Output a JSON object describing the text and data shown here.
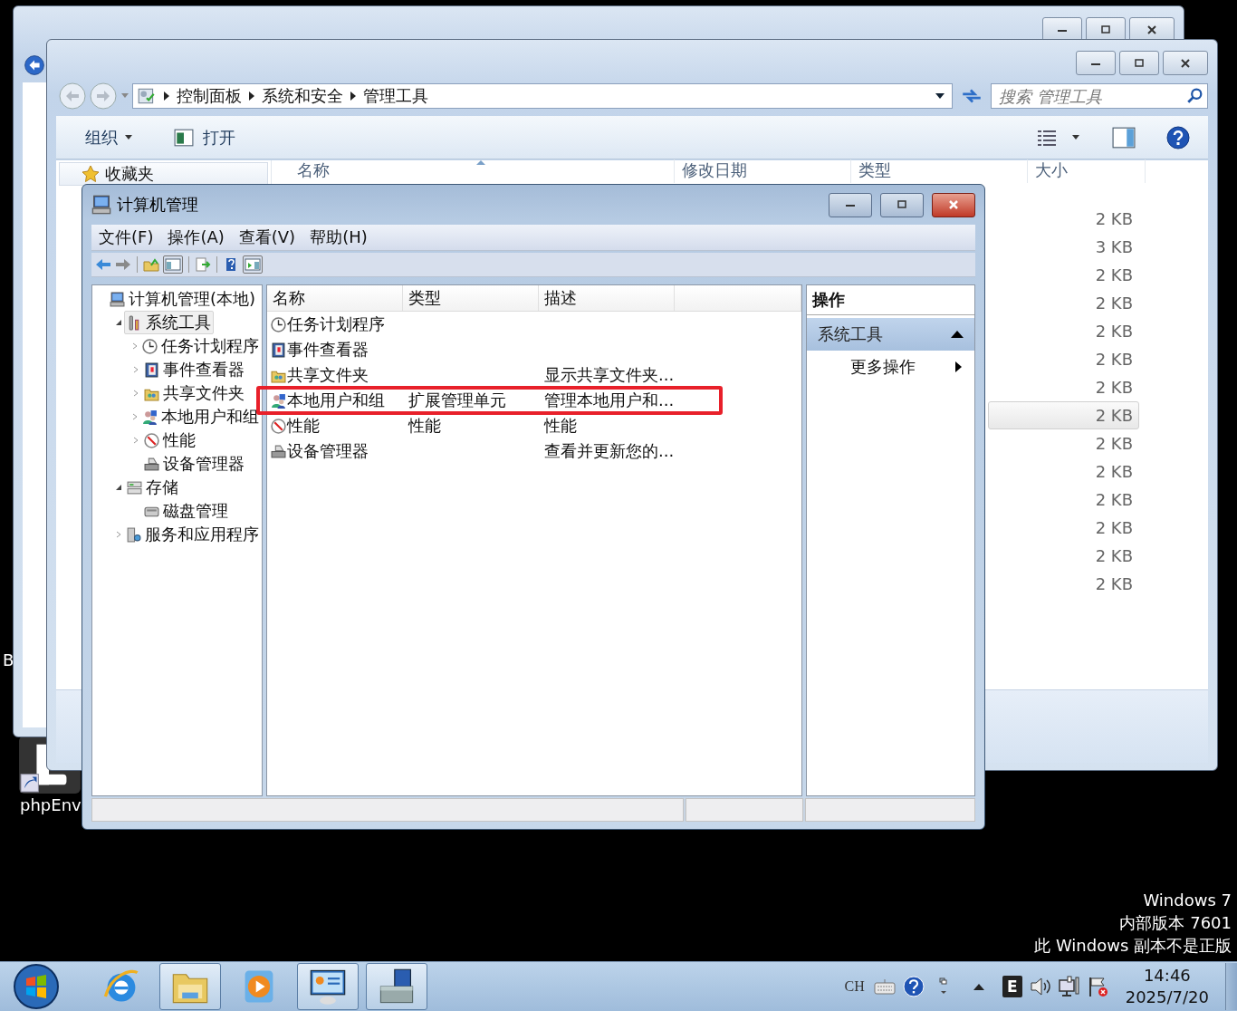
{
  "desktop": {
    "icons": [
      {
        "label": "B"
      },
      {
        "label": "phpEnv"
      }
    ],
    "watermark": [
      "Windows 7",
      "内部版本 7601",
      "此 Windows 副本不是正版"
    ]
  },
  "explorer": {
    "breadcrumb": [
      "控制面板",
      "系统和安全",
      "管理工具"
    ],
    "search": {
      "placeholder": "搜索 管理工具"
    },
    "toolbar": [
      "组织",
      "打开"
    ],
    "nav": [
      "收藏夹"
    ],
    "columns": [
      "名称",
      "修改日期",
      "类型",
      "大小"
    ],
    "rows": [
      {
        "size": "2 KB",
        "selected": false
      },
      {
        "size": "3 KB",
        "selected": false
      },
      {
        "size": "2 KB",
        "selected": false
      },
      {
        "size": "2 KB",
        "selected": false
      },
      {
        "size": "2 KB",
        "selected": false
      },
      {
        "size": "2 KB",
        "selected": false
      },
      {
        "size": "2 KB",
        "selected": false
      },
      {
        "size": "2 KB",
        "selected": true
      },
      {
        "size": "2 KB",
        "selected": false
      },
      {
        "size": "2 KB",
        "selected": false
      },
      {
        "size": "2 KB",
        "selected": false
      },
      {
        "size": "2 KB",
        "selected": false
      },
      {
        "size": "2 KB",
        "selected": false
      },
      {
        "size": "2 KB",
        "selected": false
      }
    ]
  },
  "mmc": {
    "title": "计算机管理",
    "menu": [
      "文件(F)",
      "操作(A)",
      "查看(V)",
      "帮助(H)"
    ],
    "tree": [
      {
        "label": "计算机管理(本地)",
        "selected": false,
        "children": [
          {
            "label": "系统工具",
            "selected": true,
            "expanded": true,
            "children": [
              {
                "label": "任务计划程序",
                "selected": false,
                "expanded": false
              },
              {
                "label": "事件查看器",
                "selected": false,
                "expanded": false
              },
              {
                "label": "共享文件夹",
                "selected": false,
                "expanded": false
              },
              {
                "label": "本地用户和组",
                "selected": false,
                "expanded": false
              },
              {
                "label": "性能",
                "selected": false,
                "expanded": false
              },
              {
                "label": "设备管理器",
                "selected": false
              }
            ]
          },
          {
            "label": "存储",
            "selected": false,
            "expanded": true,
            "children": [
              {
                "label": "磁盘管理",
                "selected": false
              }
            ]
          },
          {
            "label": "服务和应用程序",
            "selected": false,
            "expanded": false
          }
        ]
      }
    ],
    "columns": [
      "名称",
      "类型",
      "描述"
    ],
    "rows": [
      {
        "name": "任务计划程序",
        "marked": false
      },
      {
        "name": "事件查看器",
        "marked": false
      },
      {
        "name": "共享文件夹",
        "description": "显示共享文件夹...",
        "marked": false
      },
      {
        "name": "本地用户和组",
        "type": "扩展管理单元",
        "description": "管理本地用户和...",
        "marked": true
      },
      {
        "name": "性能",
        "type": "性能",
        "description": "性能",
        "marked": false
      },
      {
        "name": "设备管理器",
        "description": "查看并更新您的...",
        "marked": false
      }
    ],
    "actions": {
      "title": "操作",
      "sections": [
        {
          "label": "系统工具",
          "expanded": true,
          "items": [
            {
              "label": "更多操作"
            }
          ]
        }
      ]
    }
  },
  "taskbar": {
    "items": [
      {
        "running": false
      },
      {
        "running": true
      },
      {
        "running": false
      },
      {
        "running": true
      },
      {
        "running": true
      }
    ],
    "tray": {
      "language": "CH",
      "badge": "E",
      "time": "14:46",
      "date": "2025/7/20"
    }
  }
}
